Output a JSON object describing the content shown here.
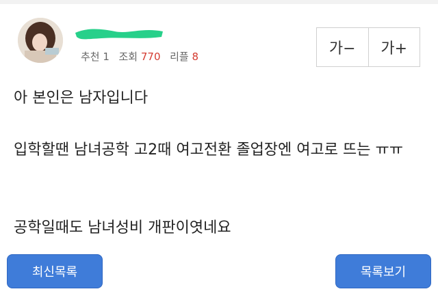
{
  "post": {
    "stats": {
      "recommend_label": "추천",
      "recommend_count": "1",
      "views_label": "조회",
      "views_count": "770",
      "replies_label": "리플",
      "replies_count": "8"
    },
    "font_controls": {
      "decrease_label": "가−",
      "increase_label": "가+"
    },
    "body": [
      "아 본인은 남자입니다",
      "입학할땐 남녀공학 고2때 여고전환 졸업장엔 여고로 뜨는 ㅠㅠ",
      "공학일때도 남녀성비 개판이엿네요"
    ]
  },
  "actions": {
    "latest_list_label": "최신목록",
    "view_list_label": "목록보기"
  },
  "colors": {
    "accent_blue": "#3f7cd9",
    "count_red": "#d43a30",
    "nickname_redaction_green": "#27d08a"
  }
}
